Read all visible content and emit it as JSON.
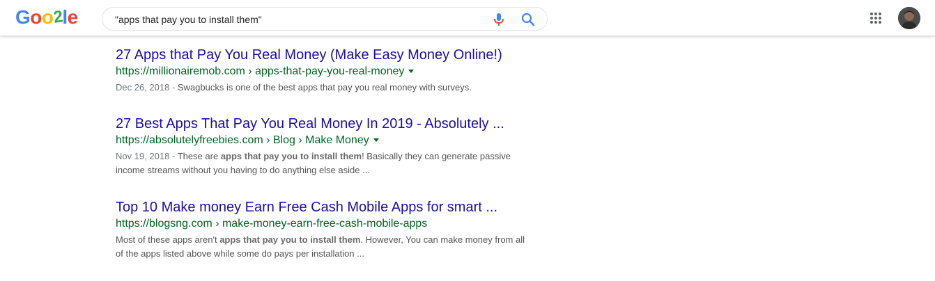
{
  "header": {
    "logo_letters": [
      "G",
      "o",
      "o",
      "2",
      "l",
      "e"
    ],
    "logo_colors": [
      "#4285f4",
      "#ea4335",
      "#fbbc05",
      "#34a853",
      "#4285f4",
      "#ea4335"
    ],
    "search_value": "\"apps that pay you to install them\""
  },
  "icons": {
    "mic": "microphone-icon",
    "search": "search-icon",
    "apps": "apps-grid-icon",
    "account": "avatar"
  },
  "colors": {
    "title": "#1a0dab",
    "url": "#006621",
    "snippet": "#545454"
  },
  "results": [
    {
      "title": "27 Apps that Pay You Real Money (Make Easy Money Online!)",
      "url": "https://millionairemob.com › apps-that-pay-you-real-money",
      "date": "Dec 26, 2018 - ",
      "snippet_parts": [
        "Swagbucks is one of the best apps that pay you real money with surveys."
      ]
    },
    {
      "title": "27 Best Apps That Pay You Real Money In 2019 - Absolutely ...",
      "url": "https://absolutelyfreebies.com › Blog › Make Money",
      "date": "Nov 19, 2018 - ",
      "snippet_parts": [
        "These are ",
        "apps that pay you to install them",
        "! Basically they can generate passive income streams without you having to do anything else aside ..."
      ]
    },
    {
      "title": "Top 10 Make money Earn Free Cash Mobile Apps for smart ...",
      "url": "https://blogsng.com › make-money-earn-free-cash-mobile-apps",
      "date": "",
      "snippet_parts": [
        "Most of these apps aren't ",
        "apps that pay you to install them",
        ". However, You can make money from all of the apps listed above while some do pays per installation ..."
      ]
    }
  ]
}
